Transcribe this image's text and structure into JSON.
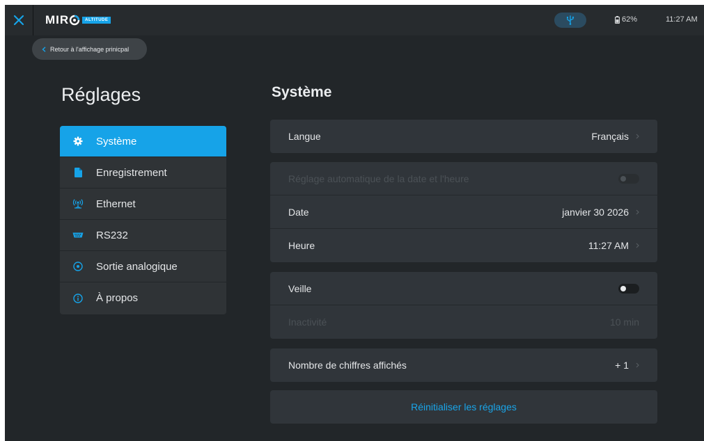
{
  "topbar": {
    "logo_text": "MIR",
    "logo_badge": "ALTITUDE",
    "battery": "62%",
    "clock": "11:27 AM",
    "icons": {
      "close": "close-icon",
      "usb": "usb-icon",
      "battery": "battery-icon",
      "logo": "miro-logo"
    }
  },
  "back_button": {
    "label": "Retour à l'affichage prinicpal",
    "icon": "chevron-left-icon"
  },
  "sidebar": {
    "title": "Réglages",
    "items": [
      {
        "label": "Système",
        "icon": "gear-icon",
        "active": true
      },
      {
        "label": "Enregistrement",
        "icon": "file-icon",
        "active": false
      },
      {
        "label": "Ethernet",
        "icon": "antenna-icon",
        "active": false
      },
      {
        "label": "RS232",
        "icon": "serial-port-icon",
        "active": false
      },
      {
        "label": "Sortie analogique",
        "icon": "target-icon",
        "active": false
      },
      {
        "label": "À propos",
        "icon": "info-icon",
        "active": false
      }
    ]
  },
  "main": {
    "title": "Système",
    "langue": {
      "label": "Langue",
      "value": "Français"
    },
    "auto_date": {
      "label": "Réglage automatique de la date et l'heure",
      "enabled": false,
      "toggle_on": false
    },
    "date": {
      "label": "Date",
      "value": "janvier 30 2026"
    },
    "heure": {
      "label": "Heure",
      "value": "11:27 AM"
    },
    "veille": {
      "label": "Veille",
      "toggle_on": false
    },
    "inactivite": {
      "label": "Inactivité",
      "value": "10 min",
      "enabled": false
    },
    "chiffres": {
      "label": "Nombre de chiffres affichés",
      "value": "+ 1"
    },
    "reset_label": "Réinitialiser les réglages"
  },
  "colors": {
    "background": "#222629",
    "topbar": "#272b2e",
    "accent": "#16a3e8",
    "card": "#30353a",
    "disabled_text": "#4b5156"
  }
}
